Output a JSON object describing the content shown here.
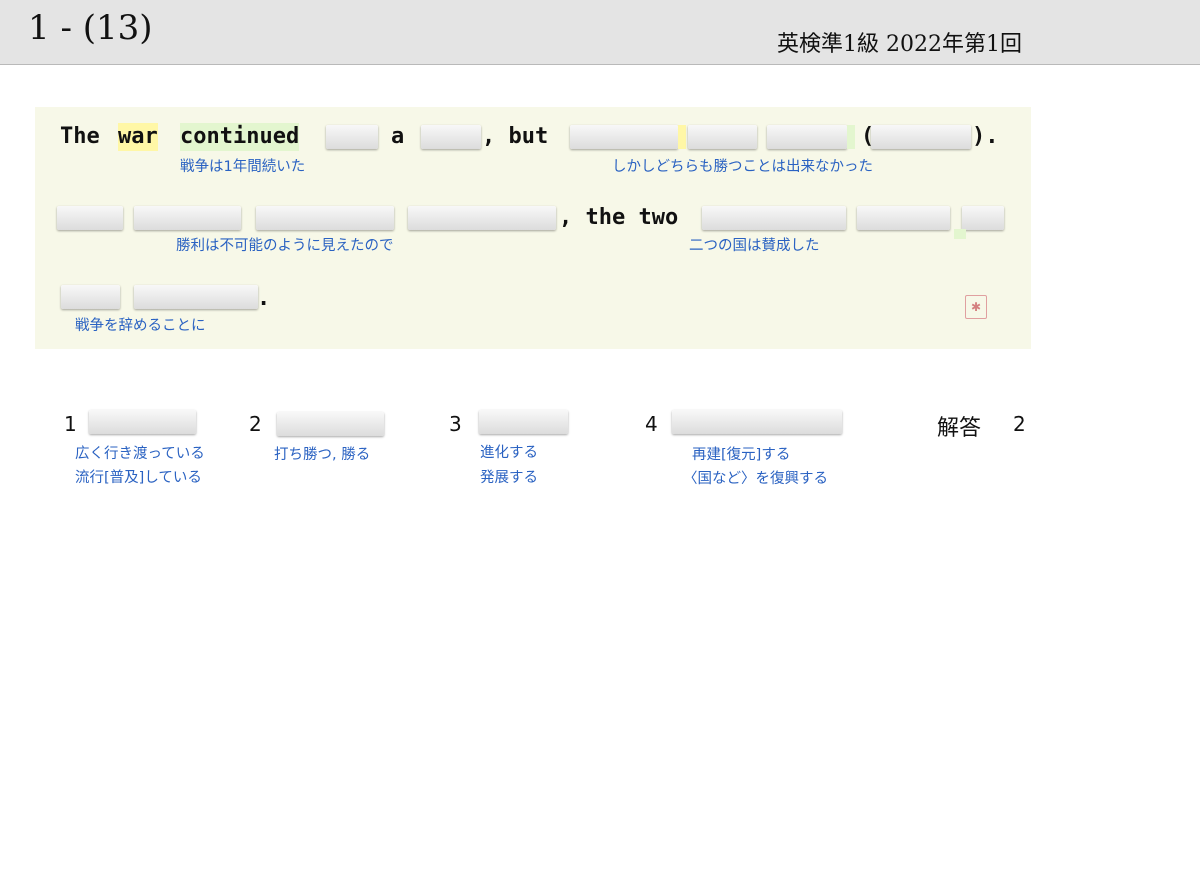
{
  "header": {
    "question_number": "1 - (13)",
    "exam_title": "英検準1級  2022年第1回"
  },
  "sentence": {
    "w_the": "The",
    "w_war": "war",
    "w_continued": "continued",
    "w_a": "a",
    "w_comma_but": ", but",
    "w_open_paren": "(",
    "w_close_paren": ").",
    "w_comma_the_two": ", the two",
    "w_period": "."
  },
  "glosses": {
    "g1": "戦争は1年間続いた",
    "g2": "しかしどちらも勝つことは出来なかった",
    "g3": "勝利は不可能のように見えたので",
    "g4": "二つの国は賛成した",
    "g5": "戦争を辞めることに"
  },
  "options": [
    {
      "number": "1",
      "gloss": [
        "広く行き渡っている",
        "流行[普及]している"
      ]
    },
    {
      "number": "2",
      "gloss": [
        "打ち勝つ, 勝る"
      ]
    },
    {
      "number": "3",
      "gloss": [
        "進化する",
        "発展する"
      ]
    },
    {
      "number": "4",
      "gloss": [
        "再建[復元]する",
        "〈国など〉を復興する"
      ]
    }
  ],
  "answer": {
    "label": "解答",
    "value": "2"
  },
  "colors": {
    "panel_bg": "#f7f8e8",
    "gloss_text": "#2a62c2",
    "highlight_yellow": "#fff7a6",
    "highlight_green": "#e3f6cf",
    "header_bg": "#e4e4e4"
  }
}
